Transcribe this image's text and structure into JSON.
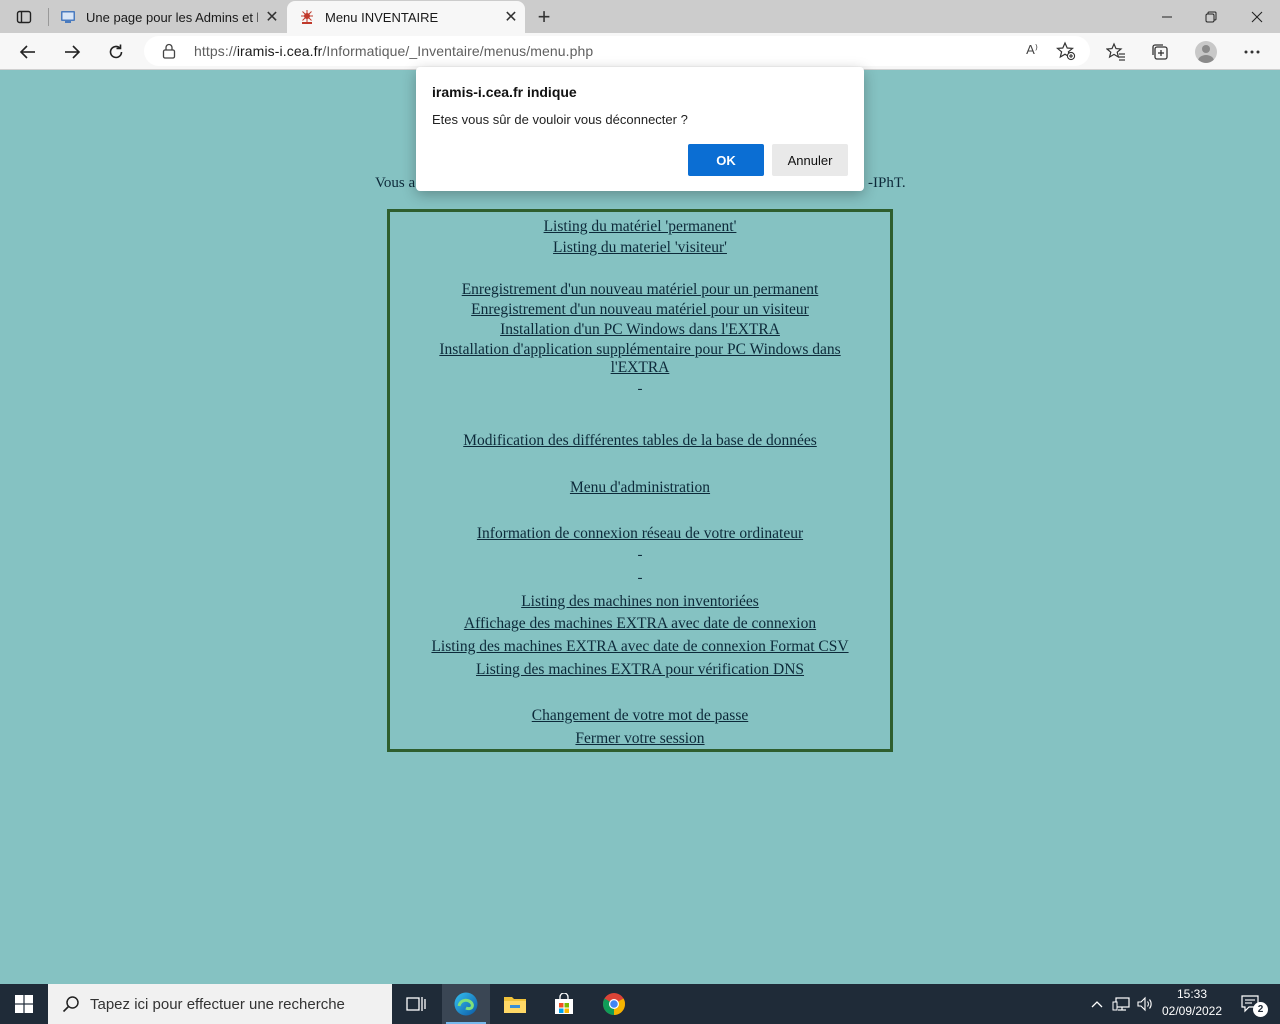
{
  "browser": {
    "tabs": [
      {
        "title": "Une page pour les Admins et les",
        "active": false
      },
      {
        "title": "Menu INVENTAIRE",
        "active": true
      }
    ],
    "address": {
      "scheme": "https://",
      "host": "iramis-i.cea.fr",
      "path": "/Informatique/_Inventaire/menus/menu.php",
      "read_aloud_label": "A⁾"
    },
    "icons": {
      "tab_actions": "tab-actions-icon",
      "back": "back-arrow-icon",
      "forward": "forward-arrow-icon",
      "refresh": "refresh-icon",
      "lock": "lock-icon",
      "favorites": "favorites-icon",
      "collections": "collections-icon",
      "profile": "profile-icon",
      "more": "more-icon"
    }
  },
  "page": {
    "intro_line1": "",
    "intro_line2_left": "Vous a",
    "intro_line2_right": "-IPhT.",
    "menu": [
      {
        "label": "Listing du matériel 'permanent'"
      },
      {
        "label": "Listing du materiel 'visiteur'"
      },
      {
        "label": "Enregistrement d'un nouveau matériel pour un permanent"
      },
      {
        "label": "Enregistrement d'un nouveau matériel pour un visiteur"
      },
      {
        "label": "Installation d'un PC Windows dans l'EXTRA"
      },
      {
        "label": "Installation d'application supplémentaire pour PC Windows dans"
      },
      {
        "label": "l'EXTRA"
      },
      {
        "label": "Modification des différentes tables de la base de données"
      },
      {
        "label": "Menu d'administration"
      },
      {
        "label": "Information de connexion réseau de votre ordinateur"
      },
      {
        "label": "Listing des machines non inventoriées"
      },
      {
        "label": "Affichage des machines EXTRA avec date de connexion"
      },
      {
        "label": "Listing des machines EXTRA avec date de connexion Format CSV"
      },
      {
        "label": "Listing des machines EXTRA pour vérification DNS"
      },
      {
        "label": "Changement de votre mot de passe"
      },
      {
        "label": "Fermer votre session"
      }
    ],
    "dash": "-"
  },
  "dialog": {
    "title": "iramis-i.cea.fr indique",
    "message": "Etes vous sûr de vouloir vous déconnecter ?",
    "ok_label": "OK",
    "cancel_label": "Annuler"
  },
  "taskbar": {
    "search_placeholder": "Tapez ici pour effectuer une recherche",
    "time": "15:33",
    "date": "02/09/2022",
    "notification_count": "2"
  }
}
